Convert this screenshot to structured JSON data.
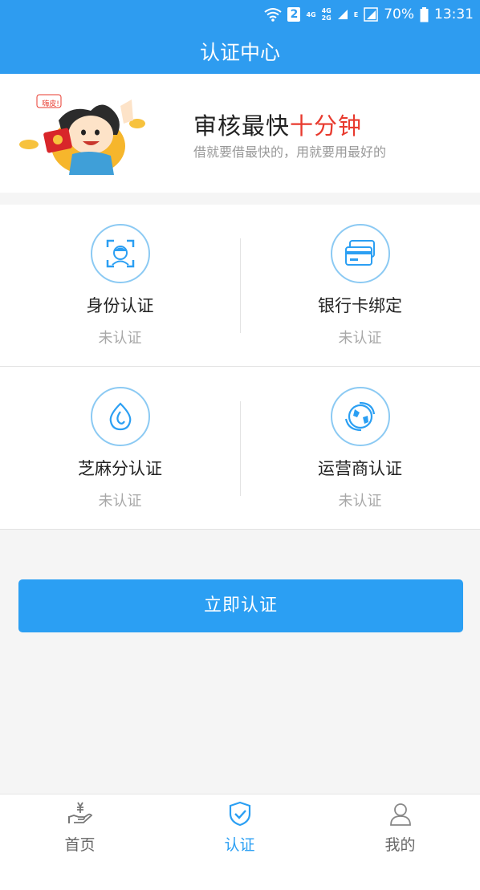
{
  "status_bar": {
    "sim_badge": "2",
    "network_1": "4G",
    "network_2_top": "4G",
    "network_2_bottom": "2G",
    "edge": "E",
    "battery": "70%",
    "time": "13:31"
  },
  "header": {
    "title": "认证中心"
  },
  "banner": {
    "bubble_text": "嗨皮!",
    "title_prefix": "审核最快",
    "title_highlight": "十分钟",
    "subtitle": "借就要借最快的，用就要用最好的"
  },
  "verifications": [
    {
      "label": "身份认证",
      "status": "未认证",
      "icon": "face-scan-icon"
    },
    {
      "label": "银行卡绑定",
      "status": "未认证",
      "icon": "bank-card-icon"
    },
    {
      "label": "芝麻分认证",
      "status": "未认证",
      "icon": "sesame-credit-icon"
    },
    {
      "label": "运营商认证",
      "status": "未认证",
      "icon": "carrier-globe-icon"
    }
  ],
  "cta": {
    "label": "立即认证"
  },
  "tabs": [
    {
      "label": "首页",
      "icon": "hand-money-icon",
      "active": false
    },
    {
      "label": "认证",
      "icon": "shield-check-icon",
      "active": true
    },
    {
      "label": "我的",
      "icon": "user-icon",
      "active": false
    }
  ],
  "colors": {
    "primary": "#2e9cf0",
    "button": "#2b9ff3",
    "highlight": "#e83a2e",
    "muted_text": "#a8a8a8",
    "icon_ring": "#8ccaf3"
  }
}
